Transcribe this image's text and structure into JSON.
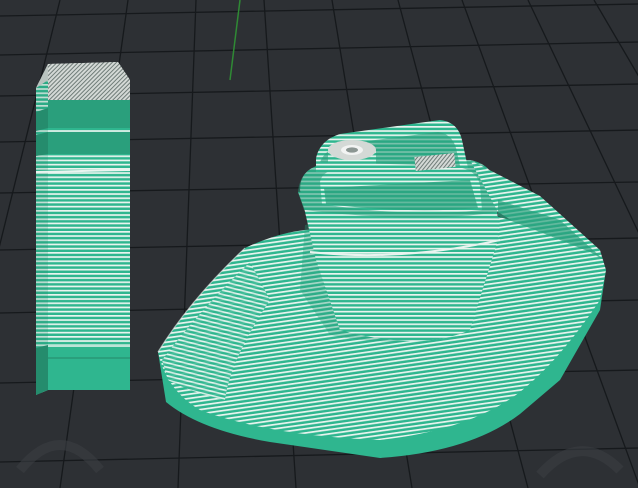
{
  "viewport": {
    "background": "#2d3034",
    "grid_line_color": "#16191c",
    "y_axis_color": "#2f8a34"
  },
  "colors": {
    "sliced_fill": "#2fb68f",
    "layer_line": "#e9f4ef",
    "solid_band": "#2a9f7c",
    "top_surface": "#d4d9d6",
    "deep_shadow": "#1f7f63"
  },
  "objects": [
    {
      "name": "calibration-tower",
      "kind": "sliced-model"
    },
    {
      "name": "benchy-boat",
      "kind": "sliced-model"
    }
  ]
}
